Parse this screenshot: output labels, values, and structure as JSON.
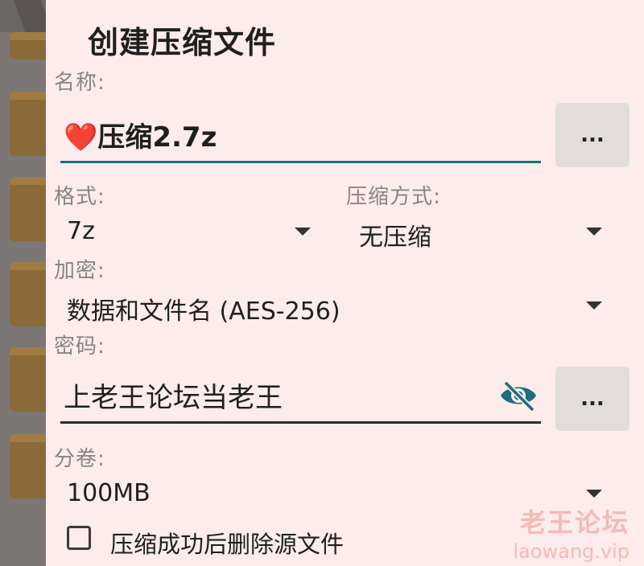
{
  "dialog": {
    "title": "创建压缩文件",
    "name": {
      "label": "名称:",
      "emoji": "❤️",
      "value": "压缩2.7z",
      "browse_label": "..."
    },
    "format": {
      "label": "格式:",
      "value": "7z"
    },
    "compression_method": {
      "label": "压缩方式:",
      "value": "无压缩"
    },
    "encryption": {
      "label": "加密:",
      "value": "数据和文件名 (AES-256)"
    },
    "password": {
      "label": "密码:",
      "value": "上老王论坛当老王",
      "visibility_icon": "eye-off-icon",
      "more_label": "..."
    },
    "split": {
      "label": "分卷:",
      "value": "100MB"
    },
    "delete_after": {
      "label": "压缩成功后删除源文件",
      "checked": false
    }
  },
  "watermark": {
    "text": "老王论坛",
    "url": "laowang.vip"
  },
  "colors": {
    "dialog_bg": "#fdeceb",
    "accent": "#1a6e7f",
    "button_bg": "#e2dcdb"
  }
}
